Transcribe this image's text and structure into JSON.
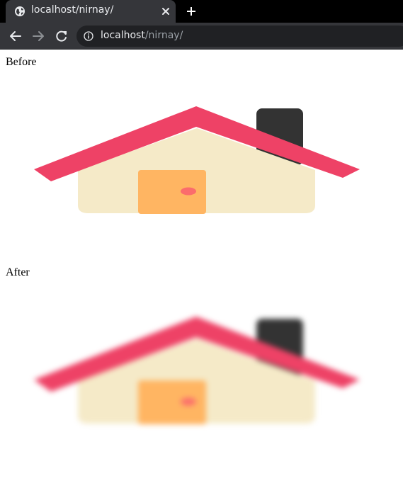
{
  "browser": {
    "tab": {
      "title": "localhost/nirnay/"
    },
    "address_bar": {
      "host": "localhost",
      "path": "/nirnay/"
    },
    "icons": {
      "tab_icon": "globe-icon",
      "close": "close-icon",
      "new_tab": "plus-icon",
      "back": "back-arrow-icon",
      "forward": "forward-arrow-icon",
      "reload": "reload-icon",
      "site_info": "info-icon"
    }
  },
  "page": {
    "before_label": "Before",
    "after_label": "After"
  },
  "colors": {
    "roof": "#ee4266",
    "wall": "#f5eac8",
    "door": "#ffb562",
    "door_knob": "#fb6c6c",
    "chimney": "#333333"
  }
}
